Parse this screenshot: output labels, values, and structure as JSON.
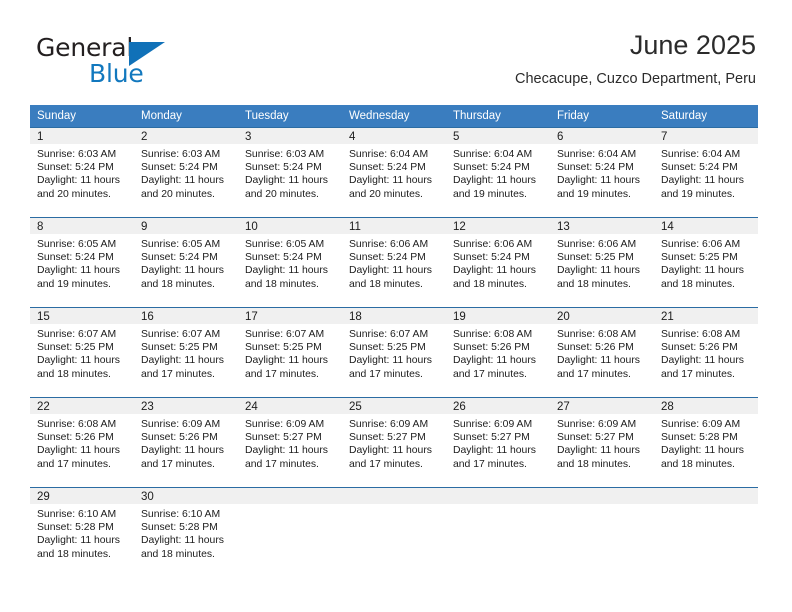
{
  "brand": {
    "name_part1": "General",
    "name_part2": "Blue",
    "flag_icon": "triangle-flag-icon"
  },
  "header": {
    "title": "June 2025",
    "subtitle": "Checacupe, Cuzco Department, Peru"
  },
  "colors": {
    "header_blue": "#3a7dbf",
    "row_divider_blue": "#2b6ca3",
    "daynum_band": "#f0f0f0",
    "brand_blue": "#1278be",
    "text": "#1c1c1c"
  },
  "weekdays": [
    "Sunday",
    "Monday",
    "Tuesday",
    "Wednesday",
    "Thursday",
    "Friday",
    "Saturday"
  ],
  "weeks": [
    [
      {
        "day": "1",
        "sunrise": "Sunrise: 6:03 AM",
        "sunset": "Sunset: 5:24 PM",
        "daylight_line1": "Daylight: 11 hours",
        "daylight_line2": "and 20 minutes."
      },
      {
        "day": "2",
        "sunrise": "Sunrise: 6:03 AM",
        "sunset": "Sunset: 5:24 PM",
        "daylight_line1": "Daylight: 11 hours",
        "daylight_line2": "and 20 minutes."
      },
      {
        "day": "3",
        "sunrise": "Sunrise: 6:03 AM",
        "sunset": "Sunset: 5:24 PM",
        "daylight_line1": "Daylight: 11 hours",
        "daylight_line2": "and 20 minutes."
      },
      {
        "day": "4",
        "sunrise": "Sunrise: 6:04 AM",
        "sunset": "Sunset: 5:24 PM",
        "daylight_line1": "Daylight: 11 hours",
        "daylight_line2": "and 20 minutes."
      },
      {
        "day": "5",
        "sunrise": "Sunrise: 6:04 AM",
        "sunset": "Sunset: 5:24 PM",
        "daylight_line1": "Daylight: 11 hours",
        "daylight_line2": "and 19 minutes."
      },
      {
        "day": "6",
        "sunrise": "Sunrise: 6:04 AM",
        "sunset": "Sunset: 5:24 PM",
        "daylight_line1": "Daylight: 11 hours",
        "daylight_line2": "and 19 minutes."
      },
      {
        "day": "7",
        "sunrise": "Sunrise: 6:04 AM",
        "sunset": "Sunset: 5:24 PM",
        "daylight_line1": "Daylight: 11 hours",
        "daylight_line2": "and 19 minutes."
      }
    ],
    [
      {
        "day": "8",
        "sunrise": "Sunrise: 6:05 AM",
        "sunset": "Sunset: 5:24 PM",
        "daylight_line1": "Daylight: 11 hours",
        "daylight_line2": "and 19 minutes."
      },
      {
        "day": "9",
        "sunrise": "Sunrise: 6:05 AM",
        "sunset": "Sunset: 5:24 PM",
        "daylight_line1": "Daylight: 11 hours",
        "daylight_line2": "and 18 minutes."
      },
      {
        "day": "10",
        "sunrise": "Sunrise: 6:05 AM",
        "sunset": "Sunset: 5:24 PM",
        "daylight_line1": "Daylight: 11 hours",
        "daylight_line2": "and 18 minutes."
      },
      {
        "day": "11",
        "sunrise": "Sunrise: 6:06 AM",
        "sunset": "Sunset: 5:24 PM",
        "daylight_line1": "Daylight: 11 hours",
        "daylight_line2": "and 18 minutes."
      },
      {
        "day": "12",
        "sunrise": "Sunrise: 6:06 AM",
        "sunset": "Sunset: 5:24 PM",
        "daylight_line1": "Daylight: 11 hours",
        "daylight_line2": "and 18 minutes."
      },
      {
        "day": "13",
        "sunrise": "Sunrise: 6:06 AM",
        "sunset": "Sunset: 5:25 PM",
        "daylight_line1": "Daylight: 11 hours",
        "daylight_line2": "and 18 minutes."
      },
      {
        "day": "14",
        "sunrise": "Sunrise: 6:06 AM",
        "sunset": "Sunset: 5:25 PM",
        "daylight_line1": "Daylight: 11 hours",
        "daylight_line2": "and 18 minutes."
      }
    ],
    [
      {
        "day": "15",
        "sunrise": "Sunrise: 6:07 AM",
        "sunset": "Sunset: 5:25 PM",
        "daylight_line1": "Daylight: 11 hours",
        "daylight_line2": "and 18 minutes."
      },
      {
        "day": "16",
        "sunrise": "Sunrise: 6:07 AM",
        "sunset": "Sunset: 5:25 PM",
        "daylight_line1": "Daylight: 11 hours",
        "daylight_line2": "and 17 minutes."
      },
      {
        "day": "17",
        "sunrise": "Sunrise: 6:07 AM",
        "sunset": "Sunset: 5:25 PM",
        "daylight_line1": "Daylight: 11 hours",
        "daylight_line2": "and 17 minutes."
      },
      {
        "day": "18",
        "sunrise": "Sunrise: 6:07 AM",
        "sunset": "Sunset: 5:25 PM",
        "daylight_line1": "Daylight: 11 hours",
        "daylight_line2": "and 17 minutes."
      },
      {
        "day": "19",
        "sunrise": "Sunrise: 6:08 AM",
        "sunset": "Sunset: 5:26 PM",
        "daylight_line1": "Daylight: 11 hours",
        "daylight_line2": "and 17 minutes."
      },
      {
        "day": "20",
        "sunrise": "Sunrise: 6:08 AM",
        "sunset": "Sunset: 5:26 PM",
        "daylight_line1": "Daylight: 11 hours",
        "daylight_line2": "and 17 minutes."
      },
      {
        "day": "21",
        "sunrise": "Sunrise: 6:08 AM",
        "sunset": "Sunset: 5:26 PM",
        "daylight_line1": "Daylight: 11 hours",
        "daylight_line2": "and 17 minutes."
      }
    ],
    [
      {
        "day": "22",
        "sunrise": "Sunrise: 6:08 AM",
        "sunset": "Sunset: 5:26 PM",
        "daylight_line1": "Daylight: 11 hours",
        "daylight_line2": "and 17 minutes."
      },
      {
        "day": "23",
        "sunrise": "Sunrise: 6:09 AM",
        "sunset": "Sunset: 5:26 PM",
        "daylight_line1": "Daylight: 11 hours",
        "daylight_line2": "and 17 minutes."
      },
      {
        "day": "24",
        "sunrise": "Sunrise: 6:09 AM",
        "sunset": "Sunset: 5:27 PM",
        "daylight_line1": "Daylight: 11 hours",
        "daylight_line2": "and 17 minutes."
      },
      {
        "day": "25",
        "sunrise": "Sunrise: 6:09 AM",
        "sunset": "Sunset: 5:27 PM",
        "daylight_line1": "Daylight: 11 hours",
        "daylight_line2": "and 17 minutes."
      },
      {
        "day": "26",
        "sunrise": "Sunrise: 6:09 AM",
        "sunset": "Sunset: 5:27 PM",
        "daylight_line1": "Daylight: 11 hours",
        "daylight_line2": "and 17 minutes."
      },
      {
        "day": "27",
        "sunrise": "Sunrise: 6:09 AM",
        "sunset": "Sunset: 5:27 PM",
        "daylight_line1": "Daylight: 11 hours",
        "daylight_line2": "and 18 minutes."
      },
      {
        "day": "28",
        "sunrise": "Sunrise: 6:09 AM",
        "sunset": "Sunset: 5:28 PM",
        "daylight_line1": "Daylight: 11 hours",
        "daylight_line2": "and 18 minutes."
      }
    ],
    [
      {
        "day": "29",
        "sunrise": "Sunrise: 6:10 AM",
        "sunset": "Sunset: 5:28 PM",
        "daylight_line1": "Daylight: 11 hours",
        "daylight_line2": "and 18 minutes."
      },
      {
        "day": "30",
        "sunrise": "Sunrise: 6:10 AM",
        "sunset": "Sunset: 5:28 PM",
        "daylight_line1": "Daylight: 11 hours",
        "daylight_line2": "and 18 minutes."
      },
      {
        "day": "",
        "sunrise": "",
        "sunset": "",
        "daylight_line1": "",
        "daylight_line2": ""
      },
      {
        "day": "",
        "sunrise": "",
        "sunset": "",
        "daylight_line1": "",
        "daylight_line2": ""
      },
      {
        "day": "",
        "sunrise": "",
        "sunset": "",
        "daylight_line1": "",
        "daylight_line2": ""
      },
      {
        "day": "",
        "sunrise": "",
        "sunset": "",
        "daylight_line1": "",
        "daylight_line2": ""
      },
      {
        "day": "",
        "sunrise": "",
        "sunset": "",
        "daylight_line1": "",
        "daylight_line2": ""
      }
    ]
  ]
}
